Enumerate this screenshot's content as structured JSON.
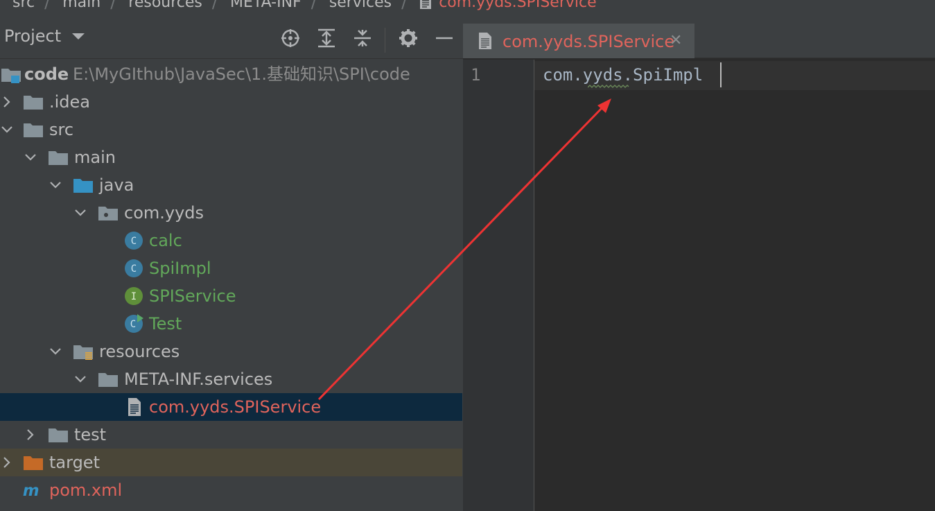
{
  "breadcrumb": {
    "items": [
      "src",
      "main",
      "resources",
      "META-INF",
      "services"
    ],
    "active": "com.yyds.SPIService"
  },
  "project_panel": {
    "title": "Project",
    "tree": {
      "root": {
        "label": "code",
        "path": "E:\\MyGIthub\\JavaSec\\1.基础知识\\SPI\\code"
      },
      "idea": ".idea",
      "src": "src",
      "main": "main",
      "java": "java",
      "package": "com.yyds",
      "class_calc": "calc",
      "class_spiimpl": "SpiImpl",
      "interface_spiservice": "SPIService",
      "class_test": "Test",
      "resources": "resources",
      "meta_inf": "META-INF.services",
      "service_file": "com.yyds.SPIService",
      "test": "test",
      "target": "target",
      "pom": "pom.xml"
    }
  },
  "editor": {
    "tab_label": "com.yyds.SPIService",
    "line_number": "1",
    "code": "com.yyds.SpiImpl"
  },
  "colors": {
    "accent": "#4a88c7",
    "modified_file": "#e0645c",
    "new_file": "#62a85a",
    "annotation_arrow": "#ee3333"
  }
}
